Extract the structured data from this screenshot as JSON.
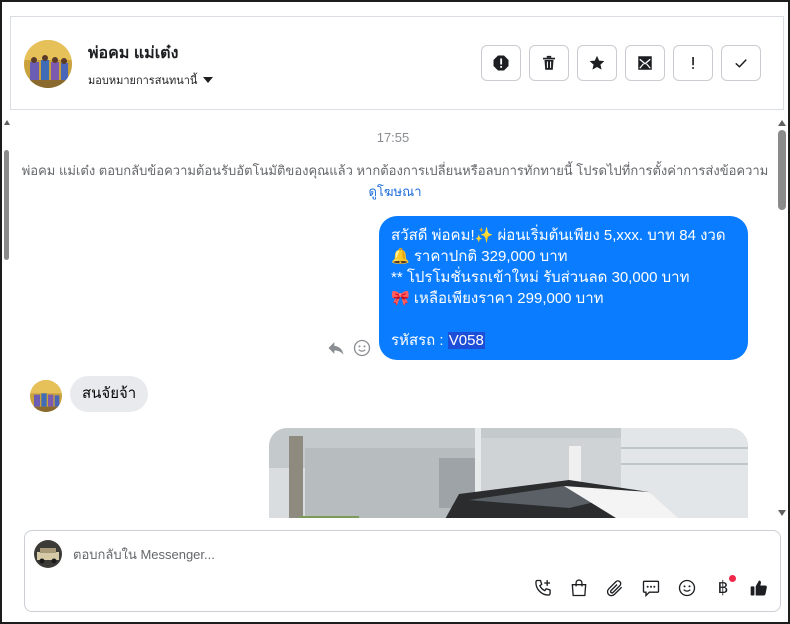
{
  "header": {
    "contact_name": "พ่อคม แม่เต๋ง",
    "assign_label": "มอบหมายการสนทนานี้"
  },
  "actions": [
    {
      "name": "spam-button",
      "icon": "alert-octagon-icon"
    },
    {
      "name": "delete-button",
      "icon": "trash-icon"
    },
    {
      "name": "star-button",
      "icon": "star-icon"
    },
    {
      "name": "mark-unread-button",
      "icon": "mail-open-icon"
    },
    {
      "name": "follow-up-button",
      "icon": "exclamation-icon"
    },
    {
      "name": "done-button",
      "icon": "check-icon"
    }
  ],
  "chat": {
    "timestamp": "17:55",
    "system_message": "พ่อคม แม่เต๋ง ตอบกลับข้อความต้อนรับอัตโนมัติของคุณแล้ว หากต้องการเปลี่ยนหรือลบการทักทายนี้ โปรดไปที่การตั้งค่าการส่งข้อความ",
    "system_link": "ดูโฆษณา",
    "outgoing": {
      "line1": "สวัสดี พ่อคม!✨  ผ่อนเริ่มต้นเพียง 5,xxx. บาท 84 งวด",
      "line2": "🔔 ราคาปกติ 329,000 บาท",
      "line3": "** โปรโมชั่นรถเข้าใหม่ รับส่วนลด 30,000 บาท",
      "line4": "🎀  เหลือเพียงราคา 299,000 บาท",
      "code_label": " รหัสรถ : ",
      "code_value": "V058"
    },
    "incoming": {
      "text": "สนจัยจ้า"
    }
  },
  "composer": {
    "placeholder": "ตอบกลับใน Messenger...",
    "baht_symbol": "฿"
  },
  "colors": {
    "accent": "#0a7cff",
    "incoming_bubble": "#e9eaed",
    "link": "#216fdb",
    "notification_dot": "#f02849"
  }
}
